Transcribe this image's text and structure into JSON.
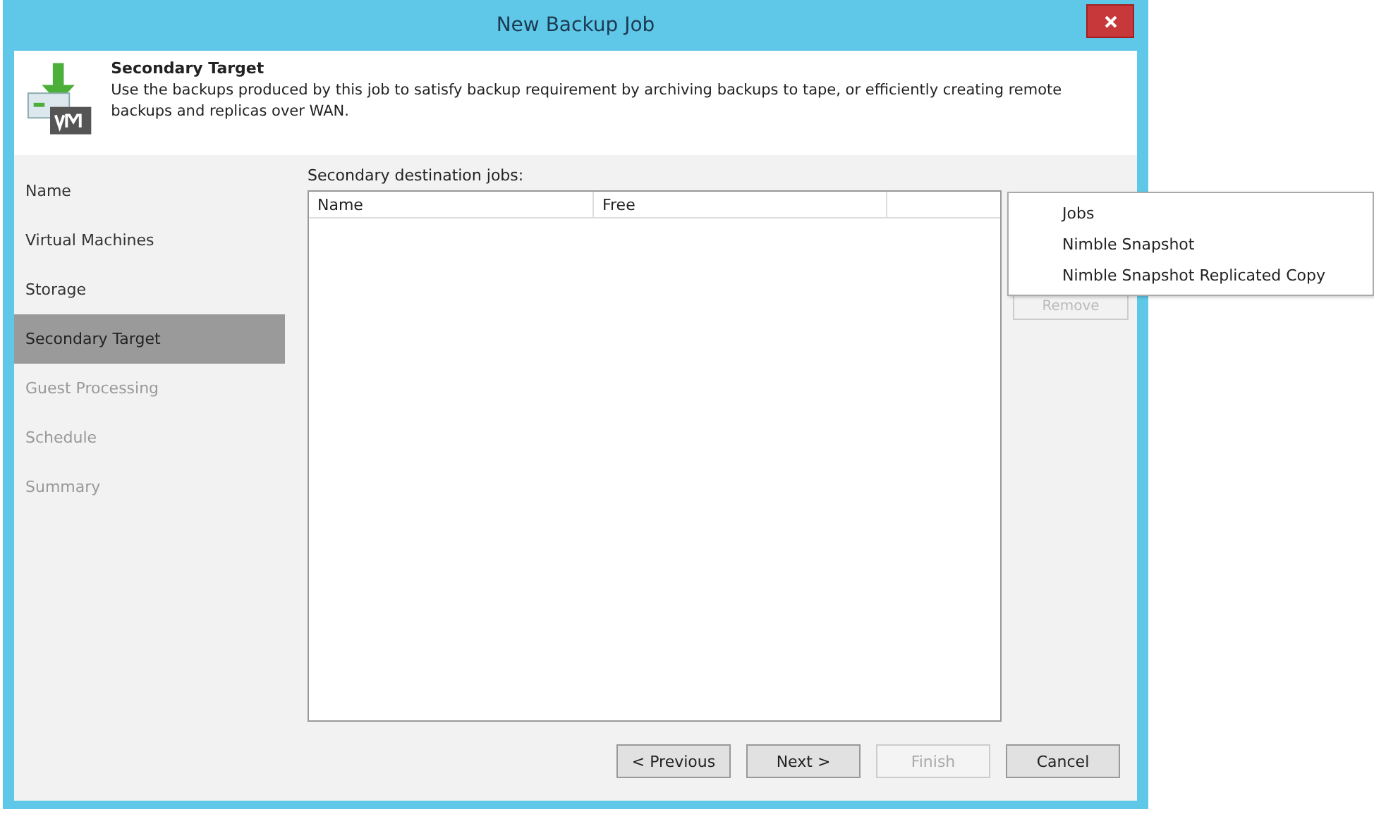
{
  "window": {
    "title": "New Backup Job"
  },
  "header": {
    "title": "Secondary Target",
    "description": "Use the backups produced by this job to satisfy backup requirement by archiving backups to tape, or efficiently creating remote backups and replicas over WAN."
  },
  "steps": [
    {
      "label": "Name",
      "selected": false,
      "disabled": false
    },
    {
      "label": "Virtual Machines",
      "selected": false,
      "disabled": false
    },
    {
      "label": "Storage",
      "selected": false,
      "disabled": false
    },
    {
      "label": "Secondary Target",
      "selected": true,
      "disabled": false
    },
    {
      "label": "Guest Processing",
      "selected": false,
      "disabled": true
    },
    {
      "label": "Schedule",
      "selected": false,
      "disabled": true
    },
    {
      "label": "Summary",
      "selected": false,
      "disabled": true
    }
  ],
  "table": {
    "label": "Secondary destination jobs:",
    "columns": [
      "Name",
      "Free"
    ]
  },
  "side_buttons": [
    {
      "label": "Remove",
      "disabled": true
    }
  ],
  "menu": {
    "items": [
      "Jobs",
      "Nimble Snapshot",
      "Nimble Snapshot Replicated Copy"
    ]
  },
  "buttons": [
    {
      "label": "< Previous",
      "disabled": false
    },
    {
      "label": "Next >",
      "disabled": false
    },
    {
      "label": "Finish",
      "disabled": true
    },
    {
      "label": "Cancel",
      "disabled": false
    }
  ]
}
